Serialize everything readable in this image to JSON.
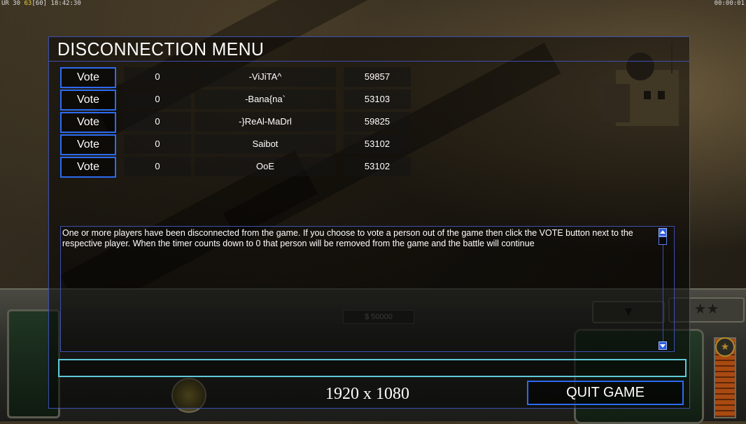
{
  "overlay": {
    "fps_prefix": "UR 30",
    "fps_value": "63",
    "fps_cap": "[60]",
    "time": "18:42:30",
    "clock": "00:00:01"
  },
  "hud": {
    "money": "$ 50000",
    "rank_stars": "★★",
    "power_icon": "star-icon"
  },
  "menu": {
    "title": "DISCONNECTION MENU",
    "vote_label": "Vote",
    "players": [
      {
        "votes": "0",
        "name": "-ViJiTA^",
        "ping": "59857"
      },
      {
        "votes": "0",
        "name": "-Bana{na`",
        "ping": "53103"
      },
      {
        "votes": "0",
        "name": "-}ReAl-MaDrl",
        "ping": "59825"
      },
      {
        "votes": "0",
        "name": "Saibot",
        "ping": "53102"
      },
      {
        "votes": "0",
        "name": "OoE",
        "ping": "53102"
      }
    ],
    "message": "One or more players have been disconnected from the game. If you choose to vote a person out of the game then click the VOTE button next to the respective player. When the timer counts down to 0 that person will be removed from the game and the battle will continue",
    "chat_value": "",
    "resolution": "1920 x 1080",
    "quit_label": "QUIT GAME"
  },
  "colors": {
    "accent_blue": "#2c6bf0",
    "frame_blue": "#3c4fb0",
    "input_cyan": "#5ec9d8"
  }
}
